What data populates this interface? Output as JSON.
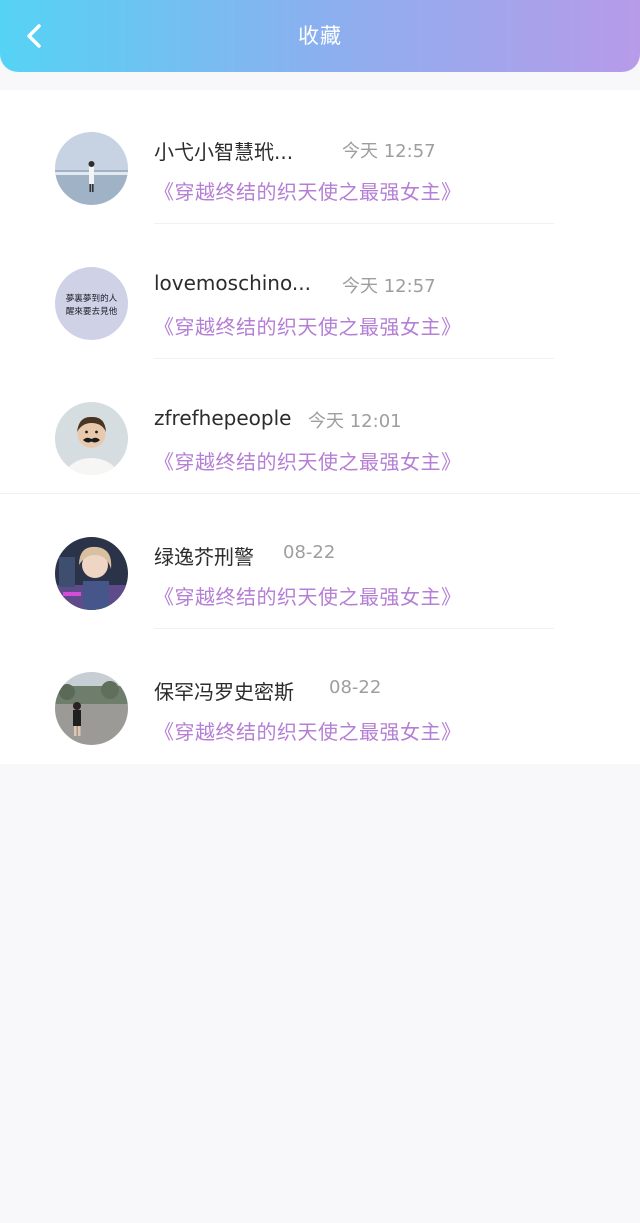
{
  "header": {
    "title": "收藏",
    "colors": {
      "gradient_start": "#55d3f4",
      "gradient_end": "#b79be9"
    }
  },
  "accent_color": "#b47fd4",
  "items": [
    {
      "name": "小弋小智慧玳...",
      "time": "今天 12:57",
      "novel": "《穿越终结的织天使之最强女主》",
      "avatar": "avatar-person-at-sea"
    },
    {
      "name": "lovemoschino...",
      "time": "今天 12:57",
      "novel": "《穿越终结的织天使之最强女主》",
      "avatar": "avatar-calligraphy-text",
      "avatar_text": [
        "夢裏夢到的人",
        "醒來要去見他"
      ]
    },
    {
      "name": "zfrefhepeople",
      "time": "今天 12:01",
      "novel": "《穿越终结的织天使之最强女主》",
      "avatar": "avatar-child-mustache"
    },
    {
      "name": "绿逸芥刑警",
      "time": "08-22",
      "novel": "《穿越终结的织天使之最强女主》",
      "avatar": "avatar-blonde-boy"
    },
    {
      "name": "保罕冯罗史密斯",
      "time": "08-22",
      "novel": "《穿越终结的织天使之最强女主》",
      "avatar": "avatar-girl-outdoors"
    }
  ]
}
